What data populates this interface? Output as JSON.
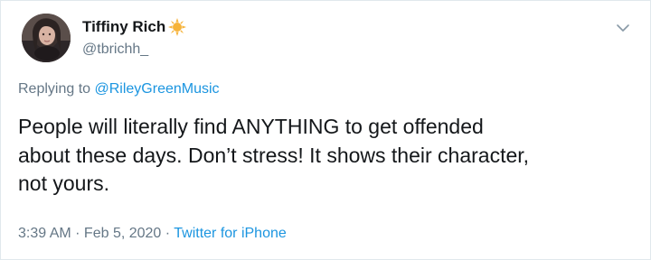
{
  "tweet": {
    "author": {
      "display_name": "Tiffiny Rich",
      "handle": "@tbrichh_",
      "badge_icon": "sun-emoji-icon",
      "avatar": "avatar-photo"
    },
    "menu_icon": "chevron-down-icon",
    "reply": {
      "prefix": "Replying to",
      "mention": "@RileyGreenMusic"
    },
    "text": "People will literally find ANYTHING to get offended\nabout these days. Don’t stress! It shows their character,\nnot yours.",
    "meta": {
      "time": "3:39 AM",
      "separator": " · ",
      "date": "Feb 5, 2020",
      "source": "Twitter for iPhone"
    }
  },
  "colors": {
    "link": "#1b95e0",
    "secondary_text": "#657786",
    "primary_text": "#14171a",
    "border": "#e1e8ed",
    "badge": "#f6b33a"
  }
}
